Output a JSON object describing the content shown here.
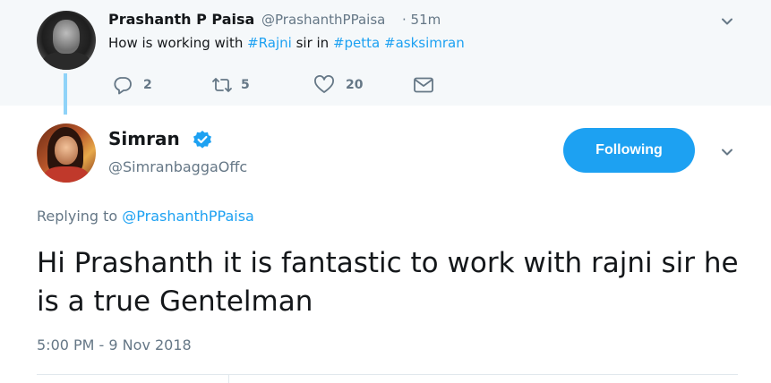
{
  "parent_tweet": {
    "name": "Prashanth P Paisa",
    "handle": "@PrashanthPPaisa",
    "time": "· 51m",
    "text_prefix": "How is working with ",
    "hashtag1": "#Rajni",
    "text_middle": " sir in ",
    "hashtag2": "#petta",
    "hashtag3": "#asksimran",
    "actions": {
      "reply_count": "2",
      "retweet_count": "5",
      "like_count": "20"
    }
  },
  "main_tweet": {
    "name": "Simran",
    "handle": "@SimranbaggaOffc",
    "follow_label": "Following",
    "replying_prefix": "Replying to ",
    "replying_handle": "@PrashanthPPaisa",
    "text": "Hi Prashanth it is fantastic to work with rajni sir he is a true Gentelman",
    "timestamp": "5:00 PM - 9 Nov 2018"
  },
  "icons": {
    "reply": "reply-icon",
    "retweet": "retweet-icon",
    "like": "heart-icon",
    "dm": "envelope-icon",
    "menu": "chevron-down-icon",
    "verified": "verified-badge-icon"
  },
  "colors": {
    "accent": "#1da1f2",
    "secondary_text": "#657786",
    "primary_text": "#14171a",
    "parent_background": "#f5f8fa"
  }
}
